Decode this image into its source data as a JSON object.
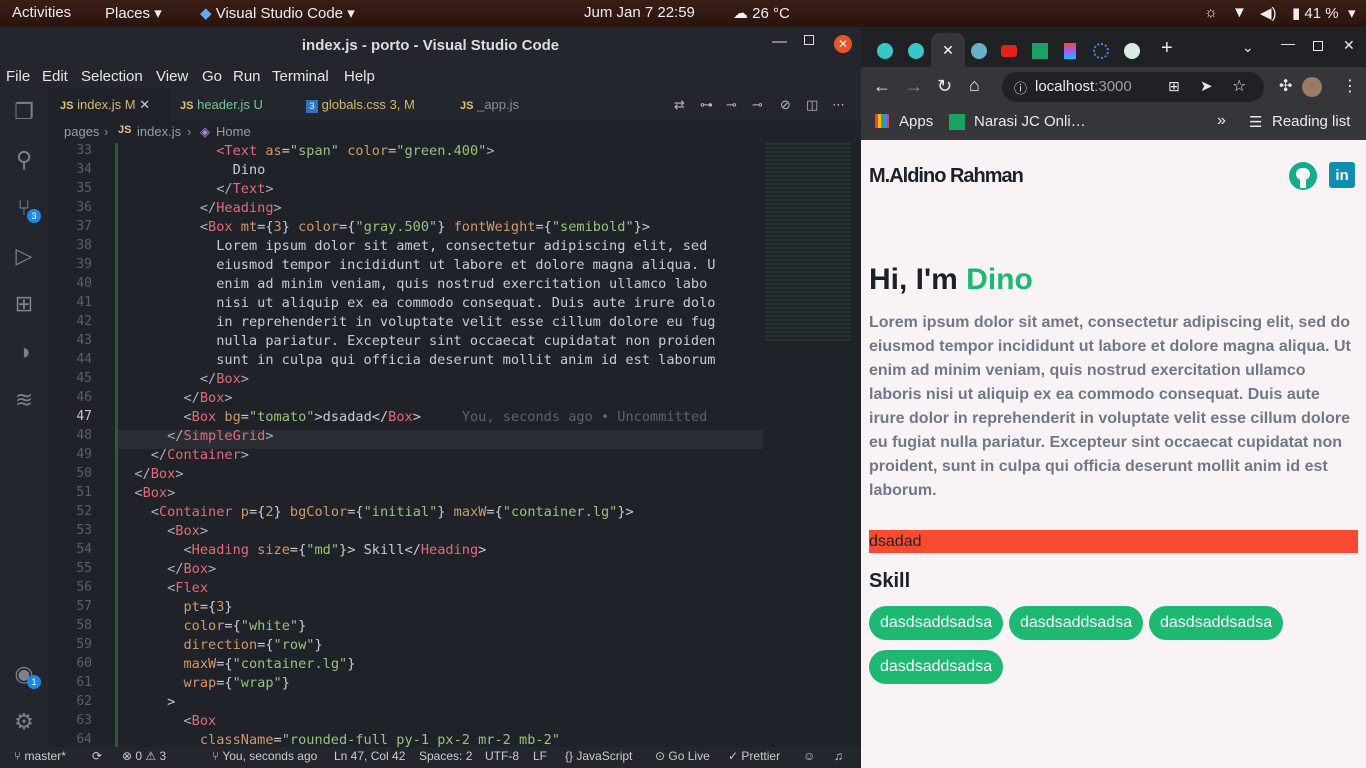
{
  "topbar": {
    "activities": "Activities",
    "places": "Places",
    "app": "Visual Studio Code",
    "clock": "Jum Jan 7  22:59",
    "weather": "26 °C",
    "battery": "41 %"
  },
  "vscode": {
    "title": "index.js - porto - Visual Studio Code",
    "menu": [
      "File",
      "Edit",
      "Selection",
      "View",
      "Go",
      "Run",
      "Terminal",
      "Help"
    ],
    "tabs": [
      {
        "icon": "JS",
        "name": "index.js",
        "flag": "M"
      },
      {
        "icon": "JS",
        "name": "header.js",
        "flag": "U"
      },
      {
        "icon": "3",
        "name": "globals.css",
        "flag": "3, M"
      },
      {
        "icon": "JS",
        "name": "_app.js",
        "flag": ""
      }
    ],
    "breadcrumb": {
      "folder": "pages",
      "file": "index.js",
      "symbol": "Home"
    },
    "source_control_badge": "3",
    "account_badge": "1",
    "lines": [
      "33",
      "34",
      "35",
      "36",
      "37",
      "38",
      "39",
      "40",
      "41",
      "42",
      "43",
      "44",
      "45",
      "46",
      "47",
      "48",
      "49",
      "50",
      "51",
      "52",
      "53",
      "54",
      "55",
      "56",
      "57",
      "58",
      "59",
      "60",
      "61",
      "62",
      "63",
      "64"
    ],
    "blame": "You, seconds ago • Uncommitted",
    "status": {
      "branch": "master*",
      "errors": "0",
      "warnings": "3",
      "blame": "You, seconds ago",
      "position": "Ln 47, Col 42",
      "spaces": "Spaces: 2",
      "encoding": "UTF-8",
      "eol": "LF",
      "language": "JavaScript",
      "golive": "Go Live",
      "prettier": "Prettier"
    }
  },
  "chrome": {
    "url_host": "localhost",
    "url_port": ":3000",
    "bookmarks": {
      "apps": "Apps",
      "item": "Narasi JC Onli…",
      "reading": "Reading list"
    },
    "page": {
      "brand": "M.Aldino Rahman",
      "hero_prefix": "Hi, I'm ",
      "hero_name": "Dino",
      "lorem": "Lorem ipsum dolor sit amet, consectetur adipiscing elit, sed do eiusmod tempor incididunt ut labore et dolore magna aliqua. Ut enim ad minim veniam, quis nostrud exercitation ullamco laboris nisi ut aliquip ex ea commodo consequat. Duis aute irure dolor in reprehenderit in voluptate velit esse cillum dolore eu fugiat nulla pariatur. Excepteur sint occaecat cupidatat non proident, sunt in culpa qui officia deserunt mollit anim id est laborum.",
      "tomato_text": "dsadad",
      "skill_title": "Skill",
      "skills": [
        "dasdsaddsadsa",
        "dasdsaddsadsa",
        "dasdsaddsadsa",
        "dasdsaddsadsa"
      ]
    },
    "colors": {
      "accent": "#1db972",
      "tomato": "#fa4b32",
      "linkedin": "#0f8fb0"
    }
  }
}
